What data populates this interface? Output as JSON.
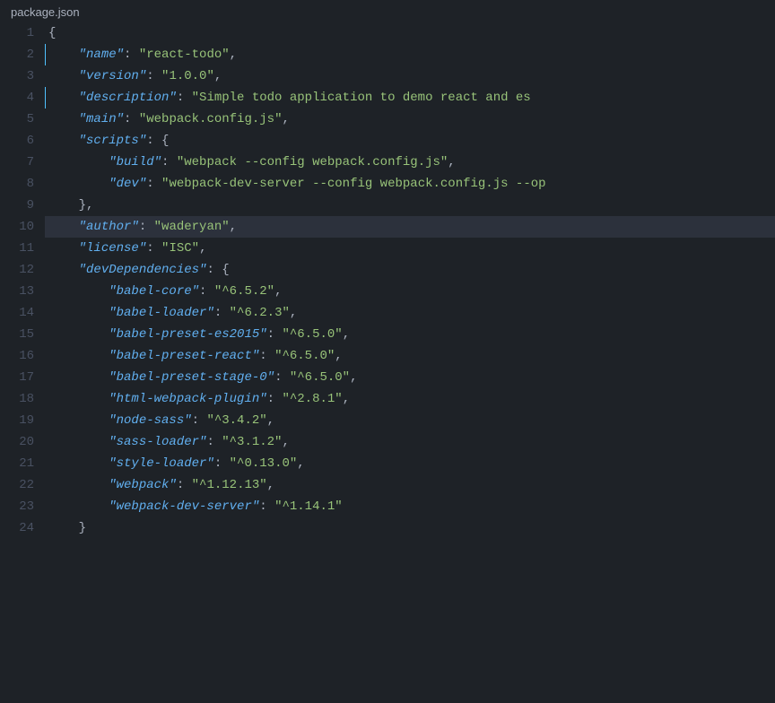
{
  "title": "package.json",
  "accent_color": "#4fc1ff",
  "background": "#1e2227",
  "line_highlight": "#2c313c",
  "lines": [
    {
      "num": 1,
      "indicator": false,
      "active": false,
      "tokens": [
        {
          "t": "brace",
          "v": "{"
        }
      ]
    },
    {
      "num": 2,
      "indicator": true,
      "active": false,
      "tokens": [
        {
          "t": "key",
          "v": "\"name\""
        },
        {
          "t": "punct",
          "v": ": "
        },
        {
          "t": "string",
          "v": "\"react-todo\""
        },
        {
          "t": "punct",
          "v": ","
        }
      ]
    },
    {
      "num": 3,
      "indicator": false,
      "active": false,
      "tokens": [
        {
          "t": "key",
          "v": "\"version\""
        },
        {
          "t": "punct",
          "v": ": "
        },
        {
          "t": "string",
          "v": "\"1.0.0\""
        },
        {
          "t": "punct",
          "v": ","
        }
      ]
    },
    {
      "num": 4,
      "indicator": true,
      "active": false,
      "tokens": [
        {
          "t": "key",
          "v": "\"description\""
        },
        {
          "t": "punct",
          "v": ": "
        },
        {
          "t": "string",
          "v": "\"Simple todo application to demo react and es"
        }
      ]
    },
    {
      "num": 5,
      "indicator": false,
      "active": false,
      "tokens": [
        {
          "t": "key",
          "v": "\"main\""
        },
        {
          "t": "punct",
          "v": ": "
        },
        {
          "t": "string",
          "v": "\"webpack.config.js\""
        },
        {
          "t": "punct",
          "v": ","
        }
      ]
    },
    {
      "num": 6,
      "indicator": false,
      "active": false,
      "tokens": [
        {
          "t": "key",
          "v": "\"scripts\""
        },
        {
          "t": "punct",
          "v": ": {"
        }
      ]
    },
    {
      "num": 7,
      "indicator": false,
      "active": false,
      "tokens": [
        {
          "t": "key",
          "v": "\"build\""
        },
        {
          "t": "punct",
          "v": ": "
        },
        {
          "t": "string",
          "v": "\"webpack --config webpack.config.js\""
        },
        {
          "t": "punct",
          "v": ","
        }
      ]
    },
    {
      "num": 8,
      "indicator": false,
      "active": false,
      "tokens": [
        {
          "t": "key",
          "v": "\"dev\""
        },
        {
          "t": "punct",
          "v": ": "
        },
        {
          "t": "string",
          "v": "\"webpack-dev-server --config webpack.config.js --op"
        }
      ]
    },
    {
      "num": 9,
      "indicator": false,
      "active": false,
      "tokens": [
        {
          "t": "punct",
          "v": "},"
        }
      ]
    },
    {
      "num": 10,
      "indicator": false,
      "active": true,
      "tokens": [
        {
          "t": "key",
          "v": "\"author\""
        },
        {
          "t": "punct",
          "v": ": "
        },
        {
          "t": "string",
          "v": "\"waderyan\""
        },
        {
          "t": "punct",
          "v": ","
        }
      ]
    },
    {
      "num": 11,
      "indicator": false,
      "active": false,
      "tokens": [
        {
          "t": "key",
          "v": "\"license\""
        },
        {
          "t": "punct",
          "v": ": "
        },
        {
          "t": "string",
          "v": "\"ISC\""
        },
        {
          "t": "punct",
          "v": ","
        }
      ]
    },
    {
      "num": 12,
      "indicator": false,
      "active": false,
      "tokens": [
        {
          "t": "key",
          "v": "\"devDependencies\""
        },
        {
          "t": "punct",
          "v": ": {"
        }
      ]
    },
    {
      "num": 13,
      "indicator": false,
      "active": false,
      "tokens": [
        {
          "t": "key",
          "v": "\"babel-core\""
        },
        {
          "t": "punct",
          "v": ": "
        },
        {
          "t": "string",
          "v": "\"^6.5.2\""
        },
        {
          "t": "punct",
          "v": ","
        }
      ]
    },
    {
      "num": 14,
      "indicator": false,
      "active": false,
      "tokens": [
        {
          "t": "key",
          "v": "\"babel-loader\""
        },
        {
          "t": "punct",
          "v": ": "
        },
        {
          "t": "string",
          "v": "\"^6.2.3\""
        },
        {
          "t": "punct",
          "v": ","
        }
      ]
    },
    {
      "num": 15,
      "indicator": false,
      "active": false,
      "tokens": [
        {
          "t": "key",
          "v": "\"babel-preset-es2015\""
        },
        {
          "t": "punct",
          "v": ": "
        },
        {
          "t": "string",
          "v": "\"^6.5.0\""
        },
        {
          "t": "punct",
          "v": ","
        }
      ]
    },
    {
      "num": 16,
      "indicator": false,
      "active": false,
      "tokens": [
        {
          "t": "key",
          "v": "\"babel-preset-react\""
        },
        {
          "t": "punct",
          "v": ": "
        },
        {
          "t": "string",
          "v": "\"^6.5.0\""
        },
        {
          "t": "punct",
          "v": ","
        }
      ]
    },
    {
      "num": 17,
      "indicator": false,
      "active": false,
      "tokens": [
        {
          "t": "key",
          "v": "\"babel-preset-stage-0\""
        },
        {
          "t": "punct",
          "v": ": "
        },
        {
          "t": "string",
          "v": "\"^6.5.0\""
        },
        {
          "t": "punct",
          "v": ","
        }
      ]
    },
    {
      "num": 18,
      "indicator": false,
      "active": false,
      "tokens": [
        {
          "t": "key",
          "v": "\"html-webpack-plugin\""
        },
        {
          "t": "punct",
          "v": ": "
        },
        {
          "t": "string",
          "v": "\"^2.8.1\""
        },
        {
          "t": "punct",
          "v": ","
        }
      ]
    },
    {
      "num": 19,
      "indicator": false,
      "active": false,
      "tokens": [
        {
          "t": "key",
          "v": "\"node-sass\""
        },
        {
          "t": "punct",
          "v": ": "
        },
        {
          "t": "string",
          "v": "\"^3.4.2\""
        },
        {
          "t": "punct",
          "v": ","
        }
      ]
    },
    {
      "num": 20,
      "indicator": false,
      "active": false,
      "tokens": [
        {
          "t": "key",
          "v": "\"sass-loader\""
        },
        {
          "t": "punct",
          "v": ": "
        },
        {
          "t": "string",
          "v": "\"^3.1.2\""
        },
        {
          "t": "punct",
          "v": ","
        }
      ]
    },
    {
      "num": 21,
      "indicator": false,
      "active": false,
      "tokens": [
        {
          "t": "key",
          "v": "\"style-loader\""
        },
        {
          "t": "punct",
          "v": ": "
        },
        {
          "t": "string",
          "v": "\"^0.13.0\""
        },
        {
          "t": "punct",
          "v": ","
        }
      ]
    },
    {
      "num": 22,
      "indicator": false,
      "active": false,
      "tokens": [
        {
          "t": "key",
          "v": "\"webpack\""
        },
        {
          "t": "punct",
          "v": ": "
        },
        {
          "t": "string",
          "v": "\"^1.12.13\""
        },
        {
          "t": "punct",
          "v": ","
        }
      ]
    },
    {
      "num": 23,
      "indicator": false,
      "active": false,
      "tokens": [
        {
          "t": "key",
          "v": "\"webpack-dev-server\""
        },
        {
          "t": "punct",
          "v": ": "
        },
        {
          "t": "string",
          "v": "\"^1.14.1\""
        }
      ]
    },
    {
      "num": 24,
      "indicator": false,
      "active": false,
      "tokens": [
        {
          "t": "brace",
          "v": "}"
        }
      ]
    }
  ],
  "indent": {
    "level1": "    ",
    "level2": "        "
  }
}
